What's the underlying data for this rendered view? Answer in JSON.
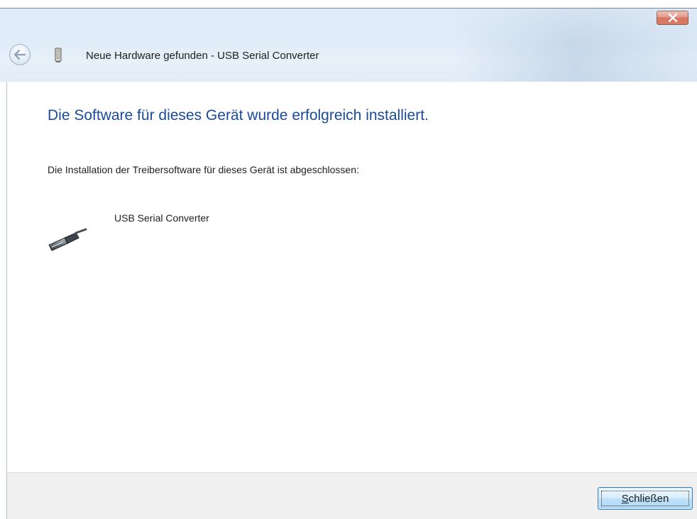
{
  "window": {
    "title": "Neue Hardware gefunden - USB Serial Converter",
    "close_symbol": "x"
  },
  "content": {
    "heading": "Die Software für dieses Gerät wurde erfolgreich installiert.",
    "description": "Die Installation der Treibersoftware für dieses Gerät ist abgeschlossen:",
    "device_name": "USB Serial Converter"
  },
  "footer": {
    "close_button_mnemonic": "S",
    "close_button_rest": "chließen"
  },
  "icons": {
    "back": "back-arrow-icon",
    "title_device": "usb-device-icon",
    "device": "usb-plug-icon",
    "close": "close-icon"
  },
  "colors": {
    "heading": "#1a4b9c",
    "close_button_red": "#c4462b",
    "footer_bg": "#f0f0f0"
  }
}
